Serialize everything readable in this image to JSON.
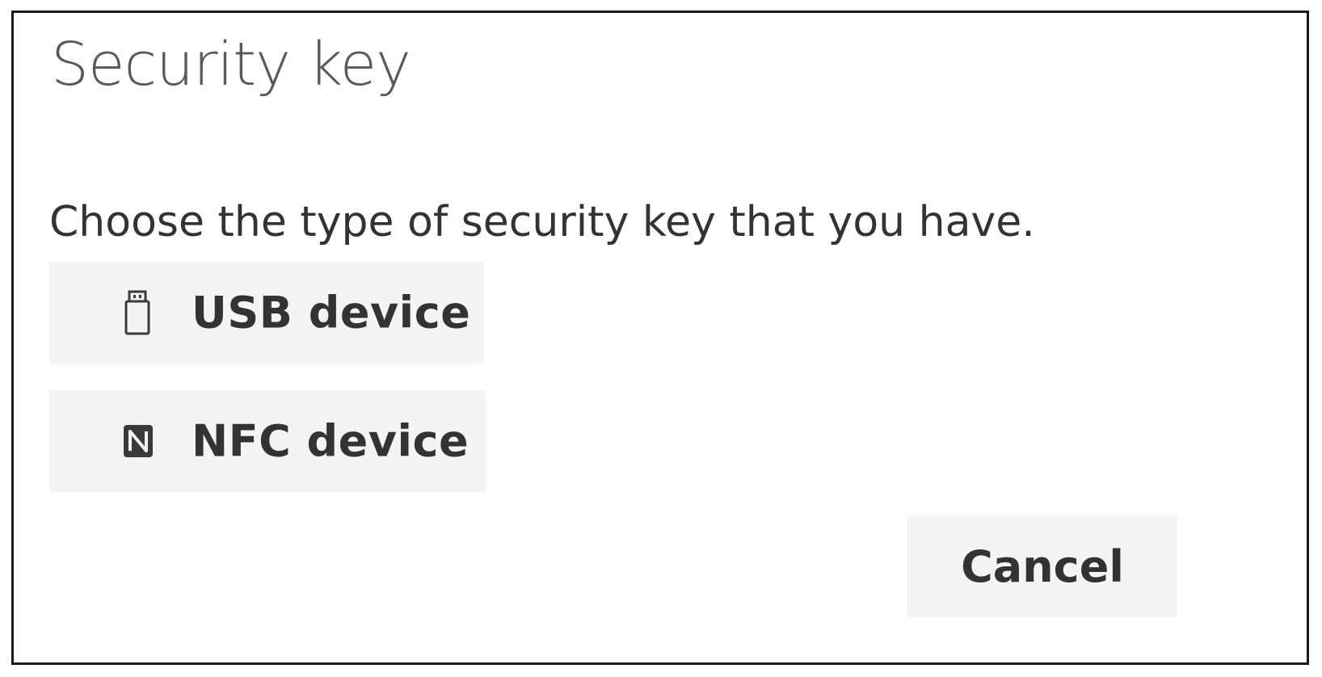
{
  "dialog": {
    "title": "Security key",
    "prompt": "Choose the type of security key that you have.",
    "options": [
      {
        "label": "USB device",
        "icon": "usb-drive-icon"
      },
      {
        "label": "NFC device",
        "icon": "nfc-icon"
      }
    ],
    "cancel_label": "Cancel"
  },
  "colors": {
    "button_background": "#f4f4f4",
    "border": "#1a1a1a",
    "text": "#333333",
    "title_text": "#5a5a5a"
  }
}
